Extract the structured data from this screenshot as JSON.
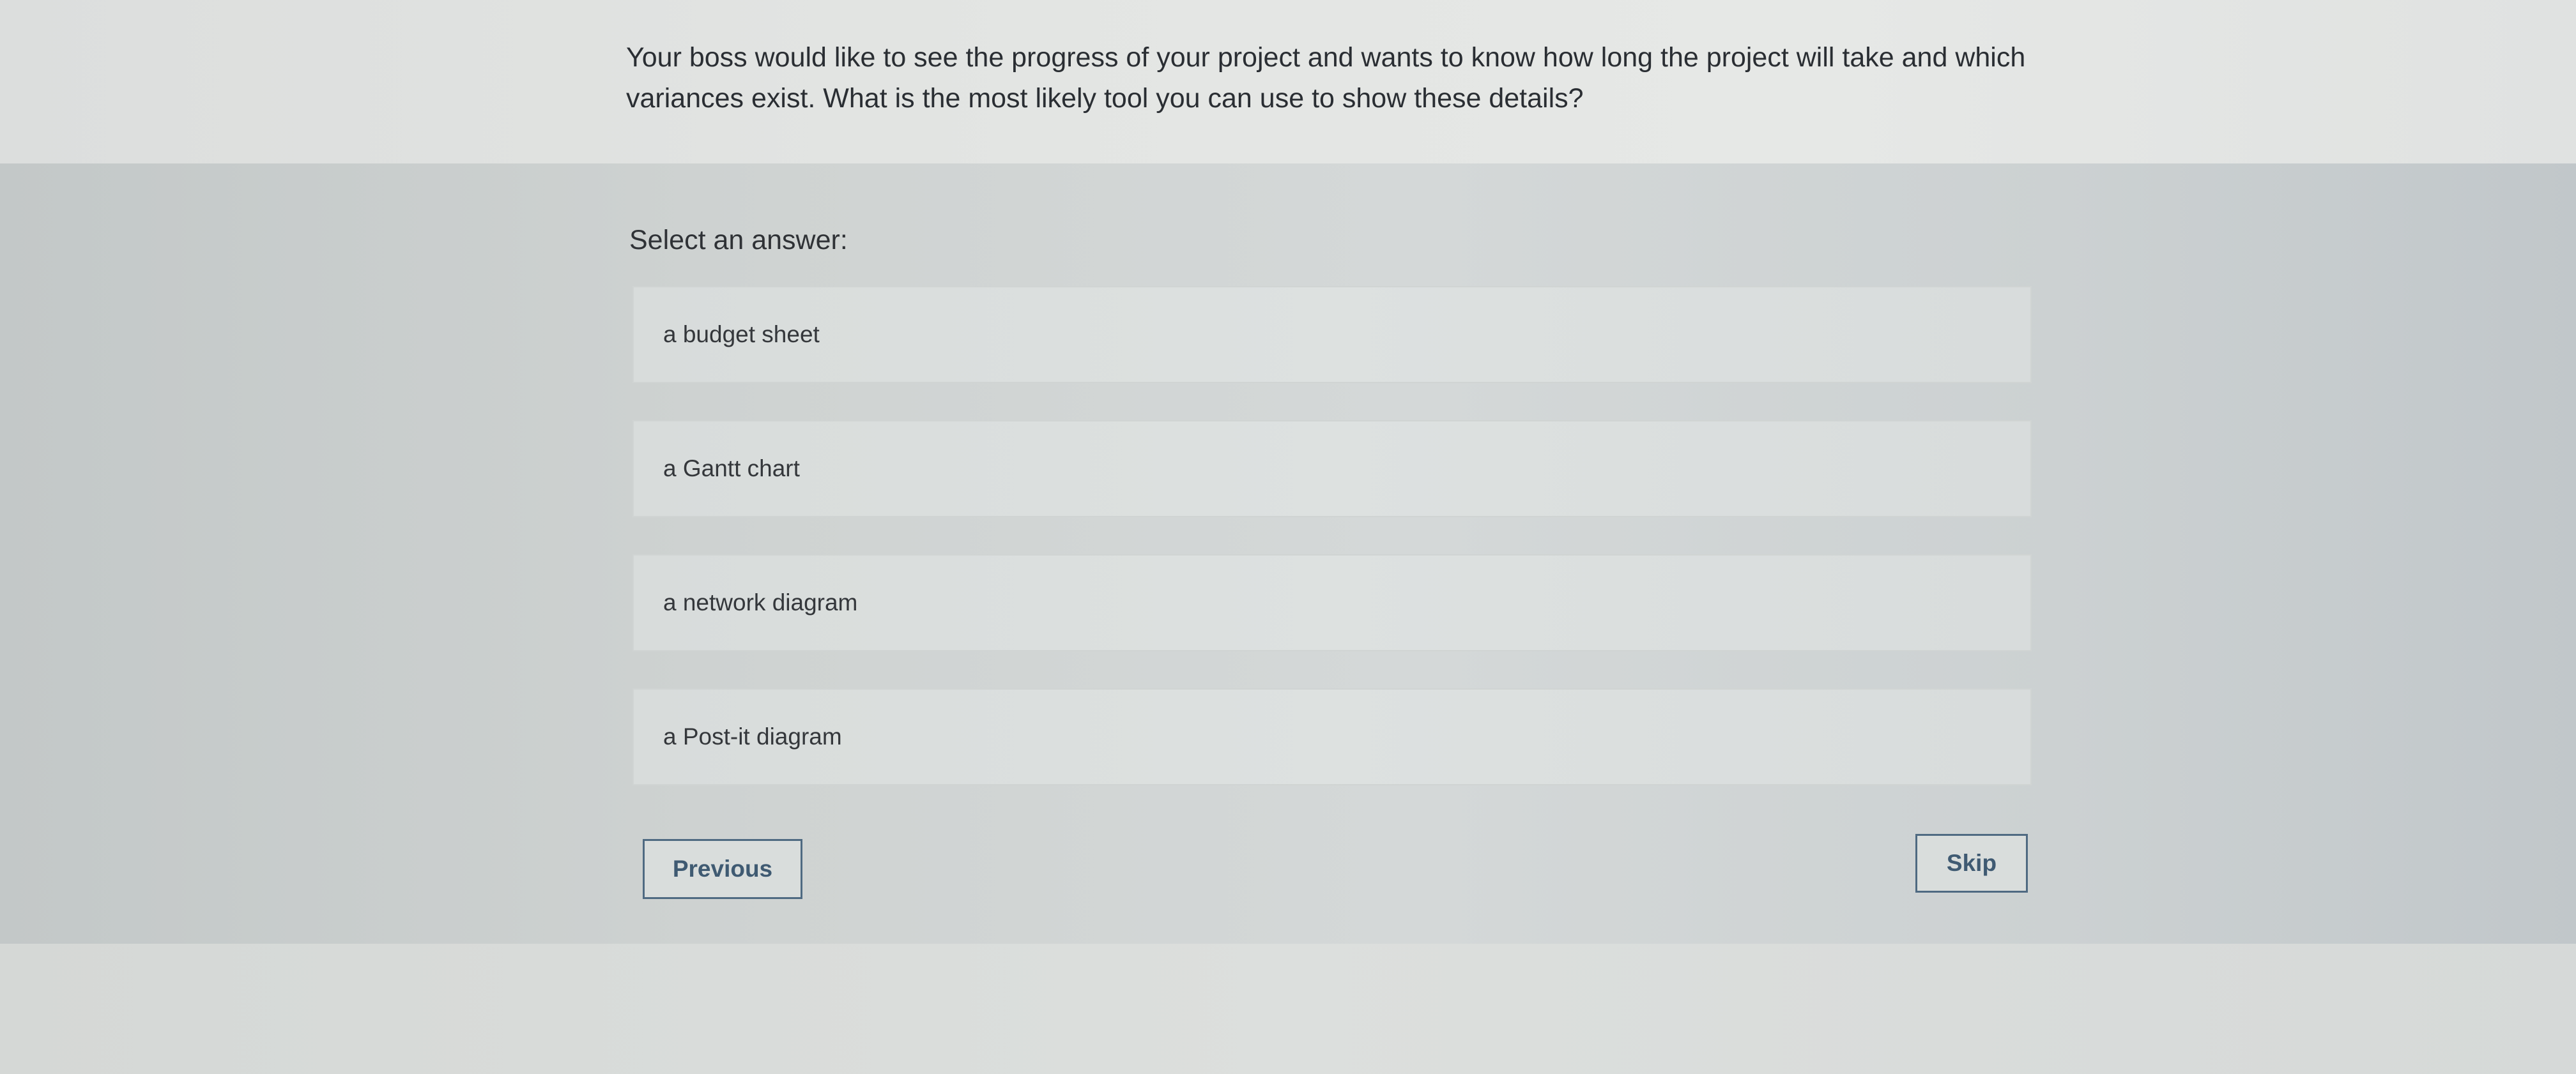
{
  "question": {
    "text": "Your boss would like to see the progress of your project and wants to know how long the project will take and which variances exist. What is the most likely tool you can use to show these details?"
  },
  "prompt": "Select an answer:",
  "options": [
    {
      "label": "a budget sheet"
    },
    {
      "label": "a Gantt chart"
    },
    {
      "label": "a network diagram"
    },
    {
      "label": "a Post-it diagram"
    }
  ],
  "navigation": {
    "previous_label": "Previous",
    "skip_label": "Skip"
  },
  "colors": {
    "button_border": "#4f6a82",
    "button_text": "#3f5a72",
    "text": "#2a2e33"
  }
}
